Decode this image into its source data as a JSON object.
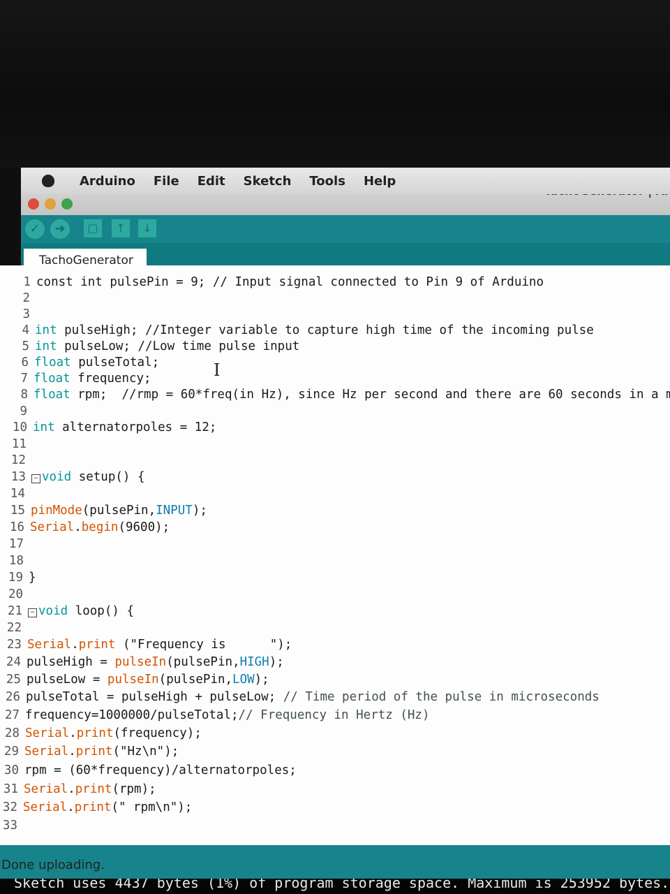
{
  "menubar": {
    "app_name": "Arduino",
    "items": [
      "File",
      "Edit",
      "Sketch",
      "Tools",
      "Help"
    ]
  },
  "window": {
    "title": "TachoGenerator | Ar"
  },
  "toolbar": {
    "verify_icon": "check-icon",
    "upload_icon": "arrow-right-icon",
    "new_icon": "new-file-icon",
    "open_icon": "arrow-up-icon",
    "save_icon": "arrow-down-icon",
    "accent_color": "#16848a"
  },
  "tab": {
    "label": "TachoGenerator"
  },
  "code": {
    "lines": [
      {
        "n": "1",
        "parts": [
          {
            "t": "const int pulsePin = 9; // Input signal connected to Pin 9 of Arduino",
            "c": ""
          }
        ]
      },
      {
        "n": "2",
        "parts": []
      },
      {
        "n": "3",
        "parts": []
      },
      {
        "n": "4",
        "parts": [
          {
            "t": "int",
            "c": "kw"
          },
          {
            "t": " pulseHigh; //Integer variable to capture high time of the incoming pulse",
            "c": ""
          }
        ]
      },
      {
        "n": "5",
        "parts": [
          {
            "t": "int",
            "c": "kw"
          },
          {
            "t": " pulseLow; //Low time pulse input",
            "c": ""
          }
        ]
      },
      {
        "n": "6",
        "parts": [
          {
            "t": "float",
            "c": "kw"
          },
          {
            "t": " pulseTotal;",
            "c": ""
          }
        ]
      },
      {
        "n": "7",
        "parts": [
          {
            "t": "float",
            "c": "kw"
          },
          {
            "t": " frequency;",
            "c": ""
          }
        ]
      },
      {
        "n": "8",
        "parts": [
          {
            "t": "float",
            "c": "kw"
          },
          {
            "t": " rpm;  //rmp = 60*freq(in Hz), since Hz per second and there are 60 seconds in a m",
            "c": ""
          }
        ]
      },
      {
        "n": "9",
        "parts": []
      },
      {
        "n": "10",
        "parts": [
          {
            "t": "int",
            "c": "kw"
          },
          {
            "t": " alternatorpoles = 12;",
            "c": ""
          }
        ]
      },
      {
        "n": "11",
        "parts": []
      },
      {
        "n": "12",
        "parts": []
      },
      {
        "n": "13",
        "fold": true,
        "parts": [
          {
            "t": "void",
            "c": "kw"
          },
          {
            "t": " setup() {",
            "c": ""
          }
        ]
      },
      {
        "n": "14",
        "parts": []
      },
      {
        "n": "15",
        "parts": [
          {
            "t": "pinMode",
            "c": "fn"
          },
          {
            "t": "(pulsePin,",
            "c": ""
          },
          {
            "t": "INPUT",
            "c": "cst"
          },
          {
            "t": ");",
            "c": ""
          }
        ]
      },
      {
        "n": "16",
        "parts": [
          {
            "t": "Serial",
            "c": "fn"
          },
          {
            "t": ".",
            "c": ""
          },
          {
            "t": "begin",
            "c": "fn"
          },
          {
            "t": "(9600);",
            "c": ""
          }
        ]
      },
      {
        "n": "17",
        "parts": []
      },
      {
        "n": "18",
        "parts": []
      },
      {
        "n": "19",
        "parts": [
          {
            "t": "}",
            "c": ""
          }
        ]
      },
      {
        "n": "20",
        "parts": []
      },
      {
        "n": "21",
        "fold": true,
        "parts": [
          {
            "t": "void",
            "c": "kw"
          },
          {
            "t": " loop() {",
            "c": ""
          }
        ]
      },
      {
        "n": "22",
        "parts": []
      },
      {
        "n": "23",
        "parts": [
          {
            "t": "Serial",
            "c": "fn"
          },
          {
            "t": ".",
            "c": ""
          },
          {
            "t": "print",
            "c": "fn"
          },
          {
            "t": " (\"Frequency is      \");",
            "c": ""
          }
        ]
      },
      {
        "n": "24",
        "parts": [
          {
            "t": "pulseHigh = ",
            "c": ""
          },
          {
            "t": "pulseIn",
            "c": "fn"
          },
          {
            "t": "(pulsePin,",
            "c": ""
          },
          {
            "t": "HIGH",
            "c": "cst"
          },
          {
            "t": ");",
            "c": ""
          }
        ]
      },
      {
        "n": "25",
        "parts": [
          {
            "t": "pulseLow = ",
            "c": ""
          },
          {
            "t": "pulseIn",
            "c": "fn"
          },
          {
            "t": "(pulsePin,",
            "c": ""
          },
          {
            "t": "LOW",
            "c": "cst"
          },
          {
            "t": ");",
            "c": ""
          }
        ]
      },
      {
        "n": "26",
        "parts": [
          {
            "t": "pulseTotal = pulseHigh + pulseLow; ",
            "c": ""
          },
          {
            "t": "// Time period of the pulse in microseconds",
            "c": "cm"
          }
        ]
      },
      {
        "n": "27",
        "parts": [
          {
            "t": "frequency=1000000/pulseTotal;",
            "c": ""
          },
          {
            "t": "// Frequency in Hertz (Hz)",
            "c": "cm"
          }
        ]
      },
      {
        "n": "28",
        "parts": [
          {
            "t": "Serial",
            "c": "fn"
          },
          {
            "t": ".",
            "c": ""
          },
          {
            "t": "print",
            "c": "fn"
          },
          {
            "t": "(frequency);",
            "c": ""
          }
        ]
      },
      {
        "n": "29",
        "parts": [
          {
            "t": "Serial",
            "c": "fn"
          },
          {
            "t": ".",
            "c": ""
          },
          {
            "t": "print",
            "c": "fn"
          },
          {
            "t": "(\"Hz\\n\");",
            "c": ""
          }
        ]
      },
      {
        "n": "30",
        "parts": [
          {
            "t": "rpm = (60*frequency)/alternatorpoles;",
            "c": ""
          }
        ]
      },
      {
        "n": "31",
        "parts": [
          {
            "t": "Serial",
            "c": "fn"
          },
          {
            "t": ".",
            "c": ""
          },
          {
            "t": "print",
            "c": "fn"
          },
          {
            "t": "(rpm);",
            "c": ""
          }
        ]
      },
      {
        "n": "32",
        "parts": [
          {
            "t": "Serial",
            "c": "fn"
          },
          {
            "t": ".",
            "c": ""
          },
          {
            "t": "print",
            "c": "fn"
          },
          {
            "t": "(\" rpm\\n\");",
            "c": ""
          }
        ]
      },
      {
        "n": "33",
        "parts": []
      }
    ]
  },
  "status": {
    "message": "Done uploading."
  },
  "console": {
    "text": "Sketch uses 4437 bytes (1%) of program storage space. Maximum is 253952 bytes."
  }
}
